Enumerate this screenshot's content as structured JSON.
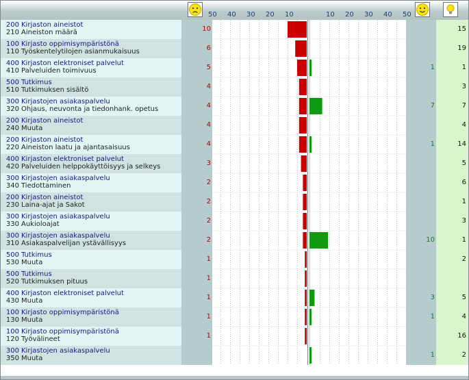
{
  "header": {
    "left_ticks": [
      "50",
      "40",
      "30",
      "20",
      "10"
    ],
    "right_ticks": [
      "10",
      "20",
      "30",
      "40",
      "50"
    ],
    "sad_icon": "sad-face-icon",
    "happy_icon": "happy-face-icon",
    "idea_icon": "lightbulb-icon"
  },
  "colors": {
    "negative_bar": "#cc0000",
    "positive_bar": "#119911",
    "row_light": "#e1f5f5",
    "row_dark": "#cfe3e3",
    "num_col": "#b5cbcc",
    "total_col": "#d9f5cc",
    "grid": "#b8b8b8",
    "axis": "#7a8b8b"
  },
  "chart_data": {
    "type": "bar",
    "orientation": "horizontal-diverging",
    "axis_max": 50,
    "grid": true,
    "rows": [
      {
        "cat_code": "200",
        "cat": "Kirjaston aineistot",
        "sub_code": "210",
        "sub": "Aineiston määrä",
        "neg": 10,
        "pos": null,
        "total": 15
      },
      {
        "cat_code": "100",
        "cat": "Kirjasto oppimisympäristönä",
        "sub_code": "110",
        "sub": "Työskentelytilojen asianmukaisuus",
        "neg": 6,
        "pos": null,
        "total": 19
      },
      {
        "cat_code": "400",
        "cat": "Kirjaston elektroniset palvelut",
        "sub_code": "410",
        "sub": "Palveluiden toimivuus",
        "neg": 5,
        "pos": 1,
        "total": 1
      },
      {
        "cat_code": "500",
        "cat": "Tutkimus",
        "sub_code": "510",
        "sub": "Tutkimuksen sisältö",
        "neg": 4,
        "pos": null,
        "total": 3
      },
      {
        "cat_code": "300",
        "cat": "Kirjastojen asiakaspalvelu",
        "sub_code": "320",
        "sub": "Ohjaus, neuvonta ja tiedonhank. opetus",
        "neg": 4,
        "pos": 7,
        "total": 7
      },
      {
        "cat_code": "200",
        "cat": "Kirjaston aineistot",
        "sub_code": "240",
        "sub": "Muuta",
        "neg": 4,
        "pos": null,
        "total": 4
      },
      {
        "cat_code": "200",
        "cat": "Kirjaston aineistot",
        "sub_code": "220",
        "sub": "Aineiston laatu ja ajantasaisuus",
        "neg": 4,
        "pos": 1,
        "total": 14
      },
      {
        "cat_code": "400",
        "cat": "Kirjaston elektroniset palvelut",
        "sub_code": "420",
        "sub": "Palveluiden helppokäyttöisyys ja selkeys",
        "neg": 3,
        "pos": null,
        "total": 5
      },
      {
        "cat_code": "300",
        "cat": "Kirjastojen asiakaspalvelu",
        "sub_code": "340",
        "sub": "Tiedottaminen",
        "neg": 2,
        "pos": null,
        "total": 6
      },
      {
        "cat_code": "200",
        "cat": "Kirjaston aineistot",
        "sub_code": "230",
        "sub": "Laina-ajat ja Sakot",
        "neg": 2,
        "pos": null,
        "total": 1
      },
      {
        "cat_code": "300",
        "cat": "Kirjastojen asiakaspalvelu",
        "sub_code": "330",
        "sub": "Aukioloajat",
        "neg": 2,
        "pos": null,
        "total": 3
      },
      {
        "cat_code": "300",
        "cat": "Kirjastojen asiakaspalvelu",
        "sub_code": "310",
        "sub": "Asiakaspalvelijan ystävällisyys",
        "neg": 2,
        "pos": 10,
        "total": 1
      },
      {
        "cat_code": "500",
        "cat": "Tutkimus",
        "sub_code": "530",
        "sub": "Muuta",
        "neg": 1,
        "pos": null,
        "total": 2
      },
      {
        "cat_code": "500",
        "cat": "Tutkimus",
        "sub_code": "520",
        "sub": "Tutkimuksen pituus",
        "neg": 1,
        "pos": null,
        "total": null
      },
      {
        "cat_code": "400",
        "cat": "Kirjaston elektroniset palvelut",
        "sub_code": "430",
        "sub": "Muuta",
        "neg": 1,
        "pos": 3,
        "total": 5
      },
      {
        "cat_code": "100",
        "cat": "Kirjasto oppimisympäristönä",
        "sub_code": "130",
        "sub": "Muuta",
        "neg": 1,
        "pos": 1,
        "total": 4
      },
      {
        "cat_code": "100",
        "cat": "Kirjasto oppimisympäristönä",
        "sub_code": "120",
        "sub": "Työvälineet",
        "neg": 1,
        "pos": null,
        "total": 16
      },
      {
        "cat_code": "300",
        "cat": "Kirjastojen asiakaspalvelu",
        "sub_code": "350",
        "sub": "Muuta",
        "neg": null,
        "pos": 1,
        "total": 2
      }
    ]
  }
}
